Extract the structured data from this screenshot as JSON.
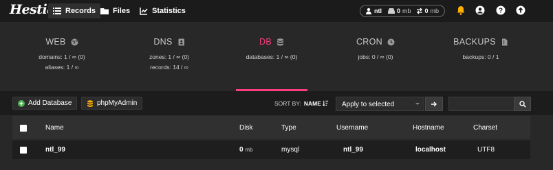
{
  "app": {
    "logo": "Hestia",
    "nav": [
      {
        "label": "Records",
        "icon": "list-icon",
        "active": true
      },
      {
        "label": "Files",
        "icon": "folder-icon",
        "active": false
      },
      {
        "label": "Statistics",
        "icon": "chart-line-icon",
        "active": false
      }
    ],
    "usage": {
      "user": "ntl",
      "disk": "0",
      "disk_unit": "mb",
      "bandwidth": "0",
      "bandwidth_unit": "mb"
    },
    "accent": "#ff3d80"
  },
  "stats": [
    {
      "name": "WEB",
      "icon": "globe-icon",
      "lines": [
        "domains: 1 / ∞ (0)",
        "aliases: 1 / ∞"
      ],
      "active": false
    },
    {
      "name": "DNS",
      "icon": "address-book-icon",
      "lines": [
        "zones: 1 / ∞ (0)",
        "records: 14 / ∞"
      ],
      "active": false
    },
    {
      "name": "DB",
      "icon": "database-icon",
      "lines": [
        "databases: 1 / ∞ (0)"
      ],
      "active": true
    },
    {
      "name": "CRON",
      "icon": "clock-icon",
      "lines": [
        "jobs: 0 / ∞ (0)"
      ],
      "active": false
    },
    {
      "name": "BACKUPS",
      "icon": "file-archive-icon",
      "lines": [
        "backups: 0 / 1"
      ],
      "active": false
    }
  ],
  "toolbar": {
    "add_label": "Add Database",
    "phpmyadmin_label": "phpMyAdmin",
    "sort_by_label": "SORT BY:",
    "sort_by_value": "NAME",
    "bulk_select": "Apply to selected",
    "search_placeholder": ""
  },
  "table": {
    "headers": [
      "Name",
      "Disk",
      "Type",
      "Username",
      "Hostname",
      "Charset"
    ],
    "rows": [
      {
        "name": "ntl_99",
        "disk": "0",
        "disk_unit": "mb",
        "type": "mysql",
        "username": "ntl_99",
        "hostname": "localhost",
        "charset": "UTF8"
      }
    ]
  }
}
